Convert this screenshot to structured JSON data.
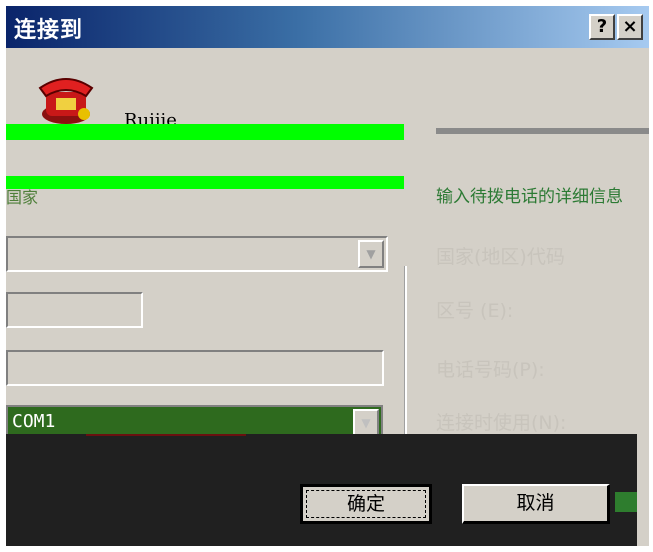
{
  "window": {
    "title": "连接到",
    "help_label": "?",
    "close_label": "×"
  },
  "connection": {
    "name": "Ruijie"
  },
  "form": {
    "country_label": "国家",
    "instruction": "输入待拨电话的详细信息",
    "country_code_label": "国家(地区)代码",
    "area_code_label": "区号 (E):",
    "phone_label": "电话号码(P):",
    "connect_using_label": "连接时使用(N):",
    "connect_using_value": "COM1"
  },
  "buttons": {
    "ok": "确定",
    "cancel": "取消"
  },
  "icons": {
    "phone": "telephone-icon",
    "dropdown": "chevron-down-icon"
  },
  "colors": {
    "title_gradient_start": "#0a246a",
    "title_gradient_end": "#a6caf0",
    "dialog_face": "#d4d0c8",
    "glitch_green": "#00ff00"
  }
}
